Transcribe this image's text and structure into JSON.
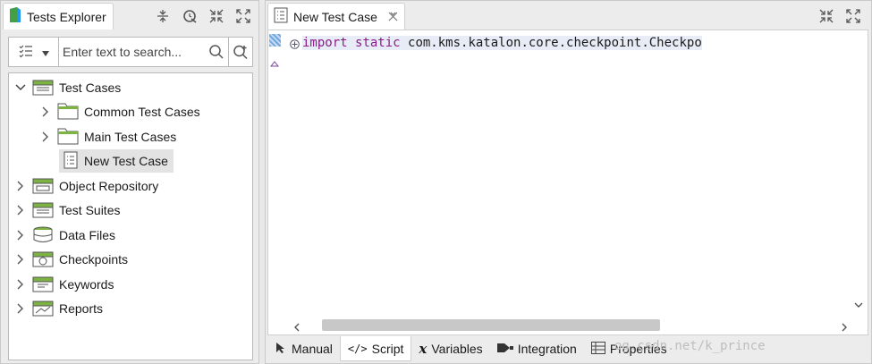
{
  "explorer": {
    "title": "Tests Explorer",
    "search_placeholder": "Enter text to search...",
    "tree": [
      {
        "label": "Test Cases",
        "icon": "test-cases-folder-icon",
        "expanded": true
      },
      {
        "label": "Common Test Cases",
        "icon": "folder-icon",
        "expanded": false
      },
      {
        "label": "Main Test Cases",
        "icon": "folder-icon",
        "expanded": false
      },
      {
        "label": "New Test Case",
        "icon": "test-case-icon",
        "selected": true
      },
      {
        "label": "Object Repository",
        "icon": "object-repository-icon"
      },
      {
        "label": "Test Suites",
        "icon": "test-suites-icon"
      },
      {
        "label": "Data Files",
        "icon": "data-files-icon"
      },
      {
        "label": "Checkpoints",
        "icon": "checkpoints-icon"
      },
      {
        "label": "Keywords",
        "icon": "keywords-icon"
      },
      {
        "label": "Reports",
        "icon": "reports-icon"
      }
    ]
  },
  "editor": {
    "tab_title": "New Test Case",
    "code": {
      "kw1": "import",
      "kw2": "static",
      "rest": " com.kms.katalon.core.checkpoint.Checkpo"
    },
    "bottom_tabs": [
      {
        "label": "Manual",
        "icon": "cursor-icon"
      },
      {
        "label": "Script",
        "icon": "code-icon",
        "active": true
      },
      {
        "label": "Variables",
        "icon": "variables-icon"
      },
      {
        "label": "Integration",
        "icon": "integration-icon"
      },
      {
        "label": "Properties",
        "icon": "properties-icon"
      }
    ],
    "watermark": "og.csdn.net/k_prince"
  },
  "colors": {
    "keyword": "#8b1a8b",
    "folder_green": "#7cb342",
    "katalon_blue": "#1e88e5"
  }
}
